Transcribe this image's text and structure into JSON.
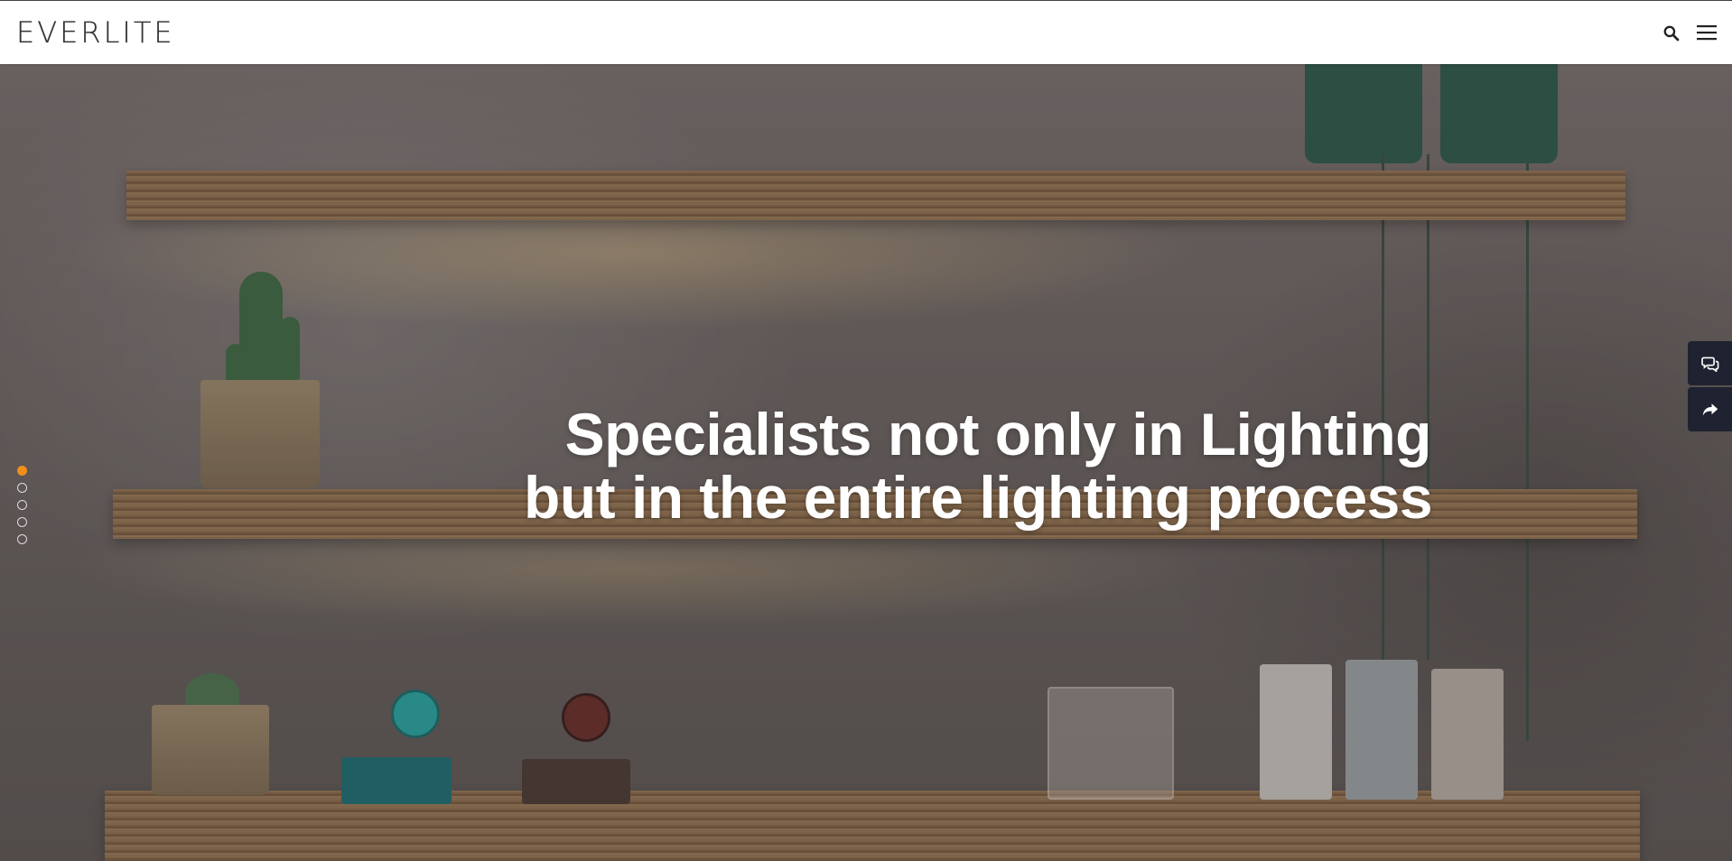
{
  "header": {
    "logo_text": "EVERLITE",
    "search_icon": "search-icon",
    "menu_icon": "hamburger-menu-icon"
  },
  "hero": {
    "headline_line1": "Specialists not only in Lighting",
    "headline_line2": "but in the entire lighting process",
    "slide_count": 5,
    "active_slide": 1
  },
  "side_actions": {
    "chat_icon": "chat-icon",
    "share_icon": "share-icon"
  },
  "colors": {
    "accent": "#f0901a",
    "side_button_bg": "#1f2230",
    "headline": "#ffffff"
  }
}
